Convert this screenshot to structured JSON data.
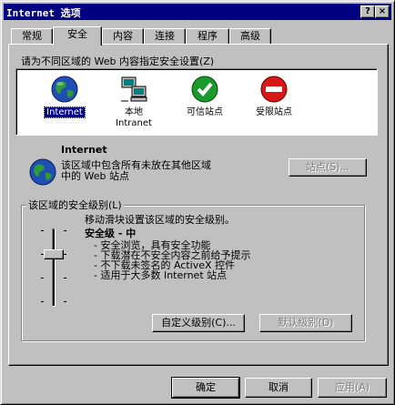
{
  "window": {
    "title": "Internet 选项",
    "help_btn": "?",
    "close_btn": "×"
  },
  "tabs": [
    {
      "label": "常规"
    },
    {
      "label": "安全",
      "active": true
    },
    {
      "label": "内容"
    },
    {
      "label": "连接"
    },
    {
      "label": "程序"
    },
    {
      "label": "高级"
    }
  ],
  "zones_prompt": "请为不同区域的 Web 内容指定安全设置(Z)",
  "zones": [
    {
      "label": "Internet",
      "icon": "globe-icon",
      "selected": true
    },
    {
      "label": "本地\nIntranet",
      "icon": "network-computer-icon"
    },
    {
      "label": "可信站点",
      "icon": "check-icon"
    },
    {
      "label": "受限站点",
      "icon": "no-entry-icon"
    }
  ],
  "zone_info": {
    "name": "Internet",
    "desc_line1": "该区域中包含所有未放在其他区域",
    "desc_line2": "中的 Web 站点",
    "sites_button": "站点(S)..."
  },
  "security_level": {
    "group_label": "该区域的安全级别(L)",
    "hint": "移动滑块设置该区域的安全级别。",
    "level_name": "安全级 - 中",
    "bullets": [
      "- 安全浏览，具有安全功能",
      "- 下载潜在不安全内容之前给予提示",
      "- 不下载未签名的 ActiveX 控件",
      "- 适用于大多数 Internet 站点"
    ],
    "slider_level_index": 1,
    "slider_positions": 4,
    "custom_button": "自定义级别(C)...",
    "default_button": "默认级别(D)"
  },
  "footer": {
    "ok": "确定",
    "cancel": "取消",
    "apply": "应用(A)"
  },
  "colors": {
    "titlebar": "#000080",
    "face": "#c0c0c0",
    "selection": "#000080"
  }
}
